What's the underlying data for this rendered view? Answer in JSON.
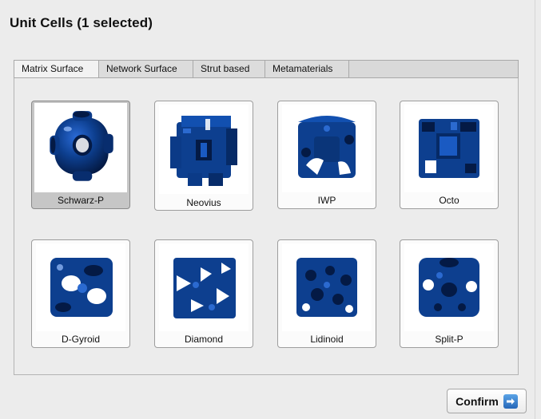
{
  "dialog": {
    "title": "Unit Cells (1 selected)"
  },
  "tabs": [
    {
      "label": "Matrix Surface",
      "active": true
    },
    {
      "label": "Network Surface",
      "active": false
    },
    {
      "label": "Strut based",
      "active": false
    },
    {
      "label": "Metamaterials",
      "active": false
    }
  ],
  "cells": [
    {
      "label": "Schwarz-P",
      "selected": true,
      "icon": "schwarz-p-lattice-icon"
    },
    {
      "label": "Neovius",
      "selected": false,
      "icon": "neovius-lattice-icon"
    },
    {
      "label": "IWP",
      "selected": false,
      "icon": "iwp-lattice-icon"
    },
    {
      "label": "Octo",
      "selected": false,
      "icon": "octo-lattice-icon"
    },
    {
      "label": "D-Gyroid",
      "selected": false,
      "icon": "d-gyroid-lattice-icon"
    },
    {
      "label": "Diamond",
      "selected": false,
      "icon": "diamond-lattice-icon"
    },
    {
      "label": "Lidinoid",
      "selected": false,
      "icon": "lidinoid-lattice-icon"
    },
    {
      "label": "Split-P",
      "selected": false,
      "icon": "split-p-lattice-icon"
    }
  ],
  "confirm": {
    "label": "Confirm",
    "icon": "arrow-right-icon"
  },
  "colors": {
    "lattice": "#0d3f8f",
    "lattice_dark": "#051c4a",
    "selected_bg": "#c6c6c6"
  }
}
